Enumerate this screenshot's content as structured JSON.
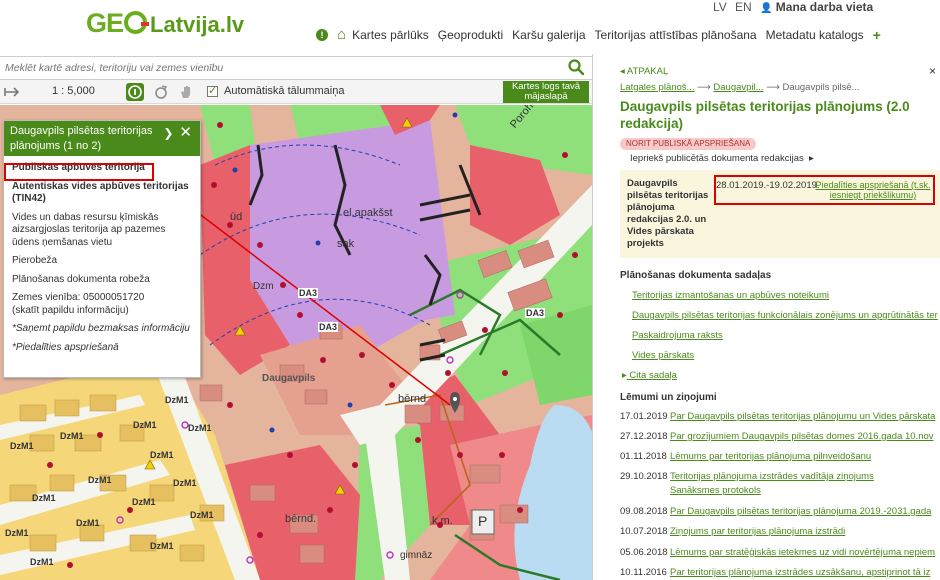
{
  "header": {
    "logo_left": "GE",
    "logo_right": "Latvija.lv",
    "lang_lv": "LV",
    "lang_en": "EN",
    "user": "Mana darba vieta",
    "nav": [
      "Kartes pārlūks",
      "Ģeoprodukti",
      "Karšu galerija",
      "Teritorijas attīstības plānošana",
      "Metadatu katalogs"
    ],
    "info_icon": "info-icon",
    "home_icon": "home-icon",
    "plus": "+"
  },
  "search": {
    "placeholder": "Meklēt kartē adresi, teritoriju vai zemes vienību"
  },
  "toolbar": {
    "scale": "1 : 5,000",
    "auto_zoom": "Automātiskā tālummaiņa",
    "open_map_btn": "Kartes logs tavā mājaslapā"
  },
  "map_labels": {
    "ud": "ūd",
    "el_apakss": "el.apakšst",
    "sak": "sak",
    "dzm": "Dzm",
    "da3a": "DA3",
    "da3b": "DA3",
    "da3c": "DA3",
    "daugavpils": "Daugavpils",
    "bernd1": "bērnd",
    "bernd2": "bērnd.",
    "km": "k.m.",
    "p": "P",
    "gimnazija": "gimnāz",
    "porohovk": "Porohovk"
  },
  "dzm_labels": [
    "DzM1",
    "DzM1",
    "DzM1",
    "DzM1",
    "DzM1",
    "DzM1",
    "DzM1",
    "DzM1",
    "DzM1",
    "DzM1",
    "DzM1",
    "DzM1",
    "DzM1",
    "DzM1",
    "DzM1"
  ],
  "popup": {
    "title": "Daugavpils pilsētas teritorijas plānojums (1 no 2)",
    "items": [
      "Publiskās apbūves teritorija",
      "Autentiskas vides apbūves teritorijas (TIN42)",
      "Vides un dabas resursu ķīmiskās aizsargjoslas teritorija ap pazemes ūdens ņemšanas vietu",
      "Pierobeža",
      "Plānošanas dokumenta robeža",
      "Zemes vienība: 05000051720",
      "(skatīt papildu informāciju)",
      "*Saņemt papildu bezmaksas informāciju",
      "*Piedalīties apspriešanā"
    ]
  },
  "panel": {
    "back": "ATPAKAĻ",
    "close": "×",
    "crumbs": [
      "Latgales plānoš...",
      "Daugavpil...",
      "Daugavpils pilsē..."
    ],
    "title": "Daugavpils pilsētas teritorijas plānojums (2.0 redakcija)",
    "badge": "NORIT PUBLISKĀ APSPRIEŠANA",
    "prev": "Iepriekš publicētās dokumenta redakcijas",
    "info_left": "Daugavpils pilsētas teritorijas plānojuma redakcijas 2.0. un Vides pārskata projekts",
    "info_date": "28.01.2019.-19.02.2019.",
    "info_link": "Piedalīties apspriešanā (t.sk. iesniegt priekšlikumu)",
    "sec_docs": "Plānošanas dokumenta sadaļas",
    "docs": [
      "Teritorijas izmantošanas un apbūves noteikumi",
      "Daugavpils pilsētas teritorijas funkcionālais zonējums un apgrūtinātās ter",
      "Paskaidrojuma raksts",
      "Vides pārskats"
    ],
    "other": "Cita sadaļa",
    "sec_news": "Lēmumi un ziņojumi",
    "news": [
      {
        "d": "17.01.2019",
        "t": "Par Daugavpils pilsētas teritorijas plānojumu un Vides pārskata"
      },
      {
        "d": "27.12.2018",
        "t": "Par grozījumiem Daugavpils pilsētas domes 2016.gada 10.nov"
      },
      {
        "d": "01.11.2018",
        "t": "Lēmums par teritorijas plānojuma pilnveidošanu"
      },
      {
        "d": "29.10.2018",
        "t": "Teritorijas plānojuma izstrādes vadītāja ziņojums"
      },
      {
        "d": "",
        "t": "Sanāksmes protokols"
      },
      {
        "d": "09.08.2018",
        "t": "Par Daugavpils pilsētas teritorijas plānojuma 2019.-2031.gada"
      },
      {
        "d": "10.07.2018",
        "t": "Ziņojums par teritorijas plānojuma izstrādi"
      },
      {
        "d": "05.06.2018",
        "t": "Lēmums par stratēģiskās ietekmes uz vidi novērtējuma nepiem"
      },
      {
        "d": "10.11.2016",
        "t": "Par teritorijas plānojuma izstrādes uzsākšanu, apstiprinot tā iz"
      }
    ]
  }
}
